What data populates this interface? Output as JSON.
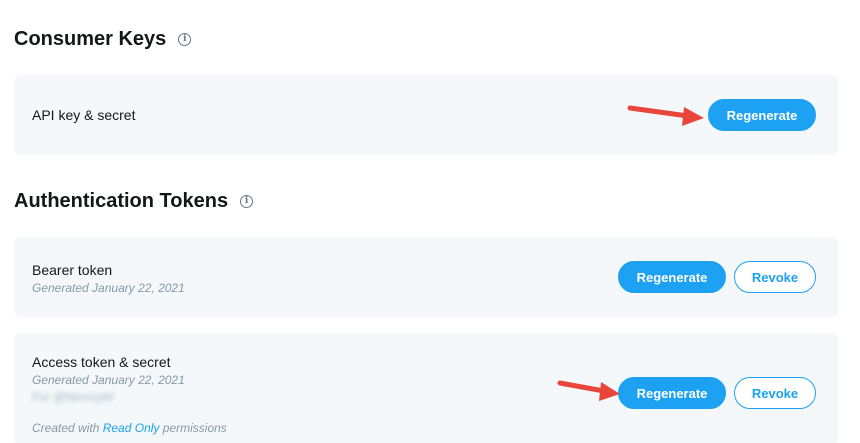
{
  "consumer_keys": {
    "title": "Consumer Keys",
    "info_icon": "info-icon",
    "api_key": {
      "label": "API key & secret",
      "regenerate_label": "Regenerate"
    }
  },
  "auth_tokens": {
    "title": "Authentication Tokens",
    "info_icon": "info-icon",
    "bearer": {
      "label": "Bearer token",
      "generated": "Generated January 22, 2021",
      "regenerate_label": "Regenerate",
      "revoke_label": "Revoke"
    },
    "access": {
      "label": "Access token & secret",
      "generated": "Generated January 22, 2021",
      "for_user": "For @NimmyM",
      "created_with_prefix": "Created with",
      "permission_link": "Read Only",
      "created_with_suffix": "permissions",
      "regenerate_label": "Regenerate",
      "revoke_label": "Revoke"
    }
  },
  "colors": {
    "accent": "#1da1f2",
    "card_bg": "#f5f8fa",
    "annotation_arrow": "#e8463a"
  }
}
